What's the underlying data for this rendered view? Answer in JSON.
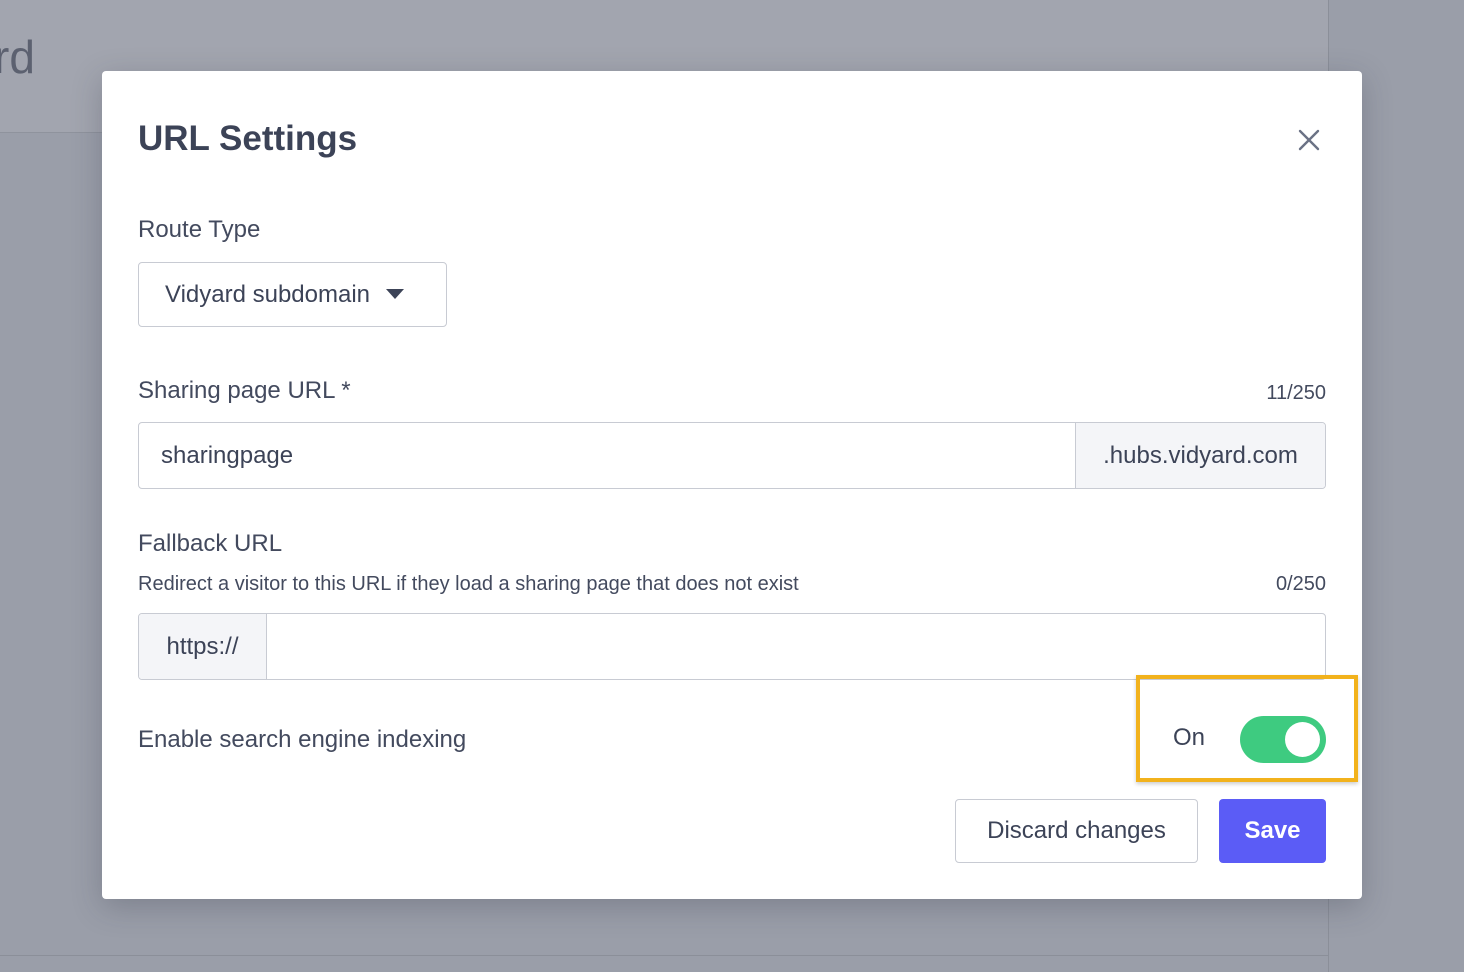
{
  "background": {
    "logo_fragment": "rd"
  },
  "modal": {
    "title": "URL Settings",
    "close_icon": "close-icon"
  },
  "route_type": {
    "label": "Route Type",
    "selected": "Vidyard subdomain",
    "caret_icon": "caret-down-icon"
  },
  "sharing_url": {
    "label": "Sharing page URL *",
    "counter": "11/250",
    "value": "sharingpage",
    "suffix": ".hubs.vidyard.com"
  },
  "fallback_url": {
    "label": "Fallback URL",
    "helper": "Redirect a visitor to this URL if they load a sharing page that does not exist",
    "counter": "0/250",
    "prefix": "https://",
    "value": ""
  },
  "indexing": {
    "label": "Enable search engine indexing",
    "state_label": "On",
    "enabled": true
  },
  "actions": {
    "discard_label": "Discard changes",
    "save_label": "Save"
  },
  "colors": {
    "toggle_on": "#3ecb80",
    "primary": "#5b5cf6",
    "highlight": "#f2b21c",
    "text": "#3c4357"
  }
}
